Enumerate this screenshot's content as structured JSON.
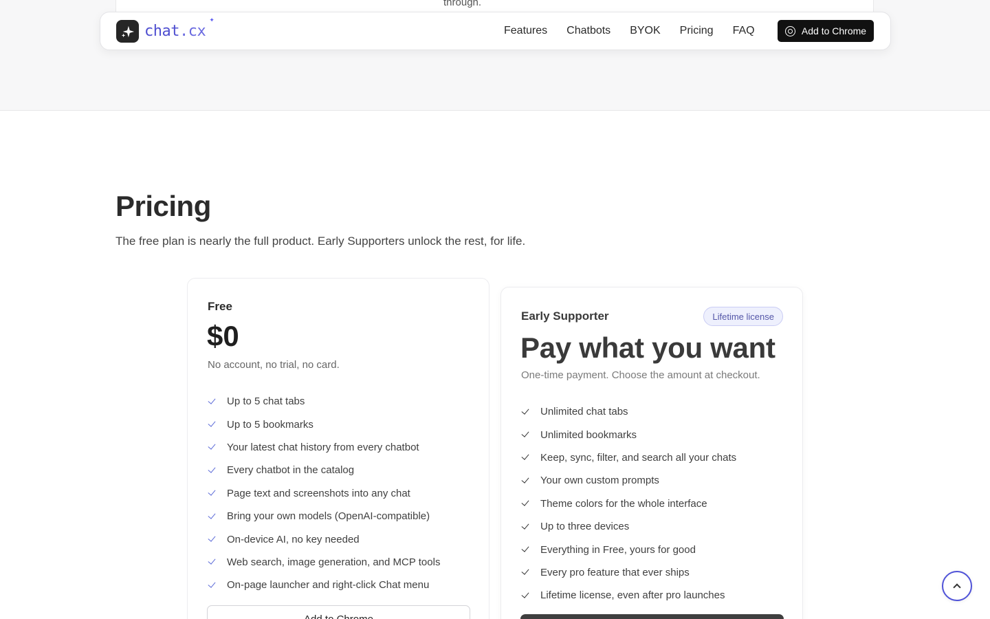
{
  "previous_section": {
    "trailing_text": "through."
  },
  "nav": {
    "logo_main": "chat",
    "logo_suffix": ".cx",
    "links": [
      "Features",
      "Chatbots",
      "BYOK",
      "Pricing",
      "FAQ"
    ],
    "cta_label": "Add to Chrome"
  },
  "pricing": {
    "title": "Pricing",
    "subtitle": "The free plan is nearly the full product. Early Supporters unlock the rest, for life.",
    "plans": [
      {
        "name": "Free",
        "price": "$0",
        "note": "No account, no trial, no card.",
        "features": [
          "Up to 5 chat tabs",
          "Up to 5 bookmarks",
          "Your latest chat history from every chatbot",
          "Every chatbot in the catalog",
          "Page text and screenshots into any chat",
          "Bring your own models (OpenAI-compatible)",
          "On-device AI, no key needed",
          "Web search, image generation, and MCP tools",
          "On-page launcher and right-click Chat menu"
        ],
        "cta_label": "Add to Chrome"
      },
      {
        "name": "Early Supporter",
        "badge": "Lifetime license",
        "price": "Pay what you want",
        "note": "One-time payment. Choose the amount at checkout.",
        "features": [
          "Unlimited chat tabs",
          "Unlimited bookmarks",
          "Keep, sync, filter, and search all your chats",
          "Your own custom prompts",
          "Theme colors for the whole interface",
          "Up to three devices",
          "Everything in Free, yours for good",
          "Every pro feature that ever ships",
          "Lifetime license, even after pro launches"
        ]
      }
    ]
  },
  "colors": {
    "accent": "#4f4fd0",
    "badge_bg": "#eef0fd",
    "dark_button": "#111111"
  },
  "icons": {
    "logo": "sparkle-logo-icon",
    "chrome": "chrome-icon",
    "check": "check-icon",
    "scroll_top": "chevron-up-icon"
  }
}
